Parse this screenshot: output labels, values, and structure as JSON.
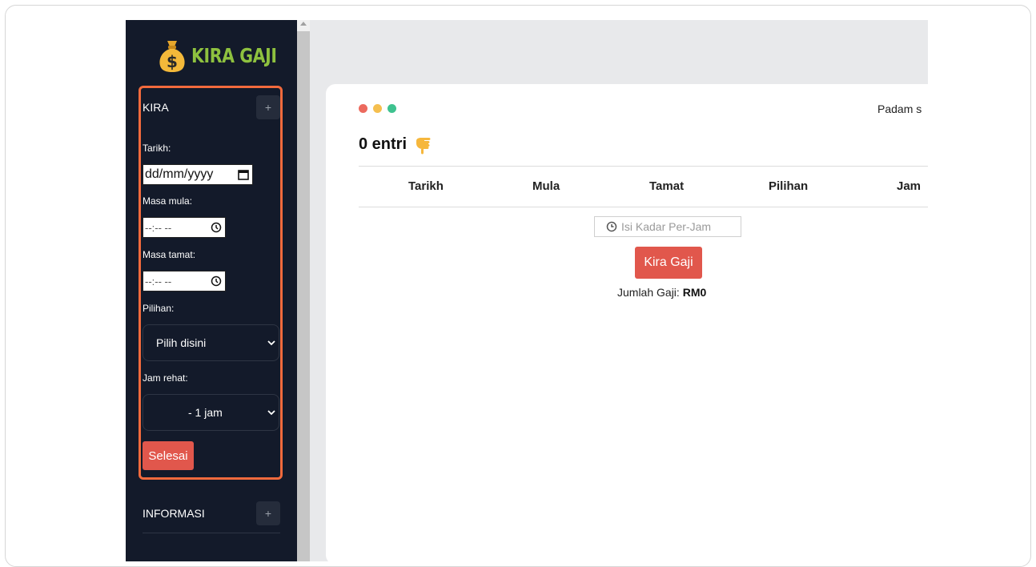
{
  "logo": {
    "text": "KIRA GAJI"
  },
  "sidebar": {
    "kira_section": {
      "title": "KIRA",
      "toggle": "+",
      "date_label": "Tarikh:",
      "date_value": "dd/mm/yyyy",
      "start_label": "Masa mula:",
      "start_value": "--:-- --",
      "end_label": "Masa tamat:",
      "end_value": "--:-- --",
      "option_label": "Pilihan:",
      "option_selected": "Pilih disini",
      "break_label": "Jam rehat:",
      "break_selected": "- 1 jam",
      "submit": "Selesai"
    },
    "info_section": {
      "title": "INFORMASI",
      "toggle": "+"
    }
  },
  "main": {
    "window_dots": [
      "#ec6a5e",
      "#f5bf4f",
      "#3ec28f"
    ],
    "clear_text": "Padam s",
    "entries_title": "0 entri",
    "table_headers": [
      "Tarikh",
      "Mula",
      "Tamat",
      "Pilihan",
      "Jam"
    ],
    "rate_placeholder": "Isi Kadar Per-Jam",
    "calculate_button": "Kira Gaji",
    "total_label": "Jumlah Gaji:",
    "total_value": "RM0"
  },
  "colors": {
    "accent_red": "#e1574c",
    "sidebar_bg": "#131a2a",
    "logo_green": "#8ec13f",
    "highlight": "#f26a3d"
  },
  "icons": [
    "money-bag-icon",
    "plus-icon",
    "calendar-icon",
    "clock-icon",
    "chevron-down-icon",
    "pointing-hand-icon"
  ]
}
